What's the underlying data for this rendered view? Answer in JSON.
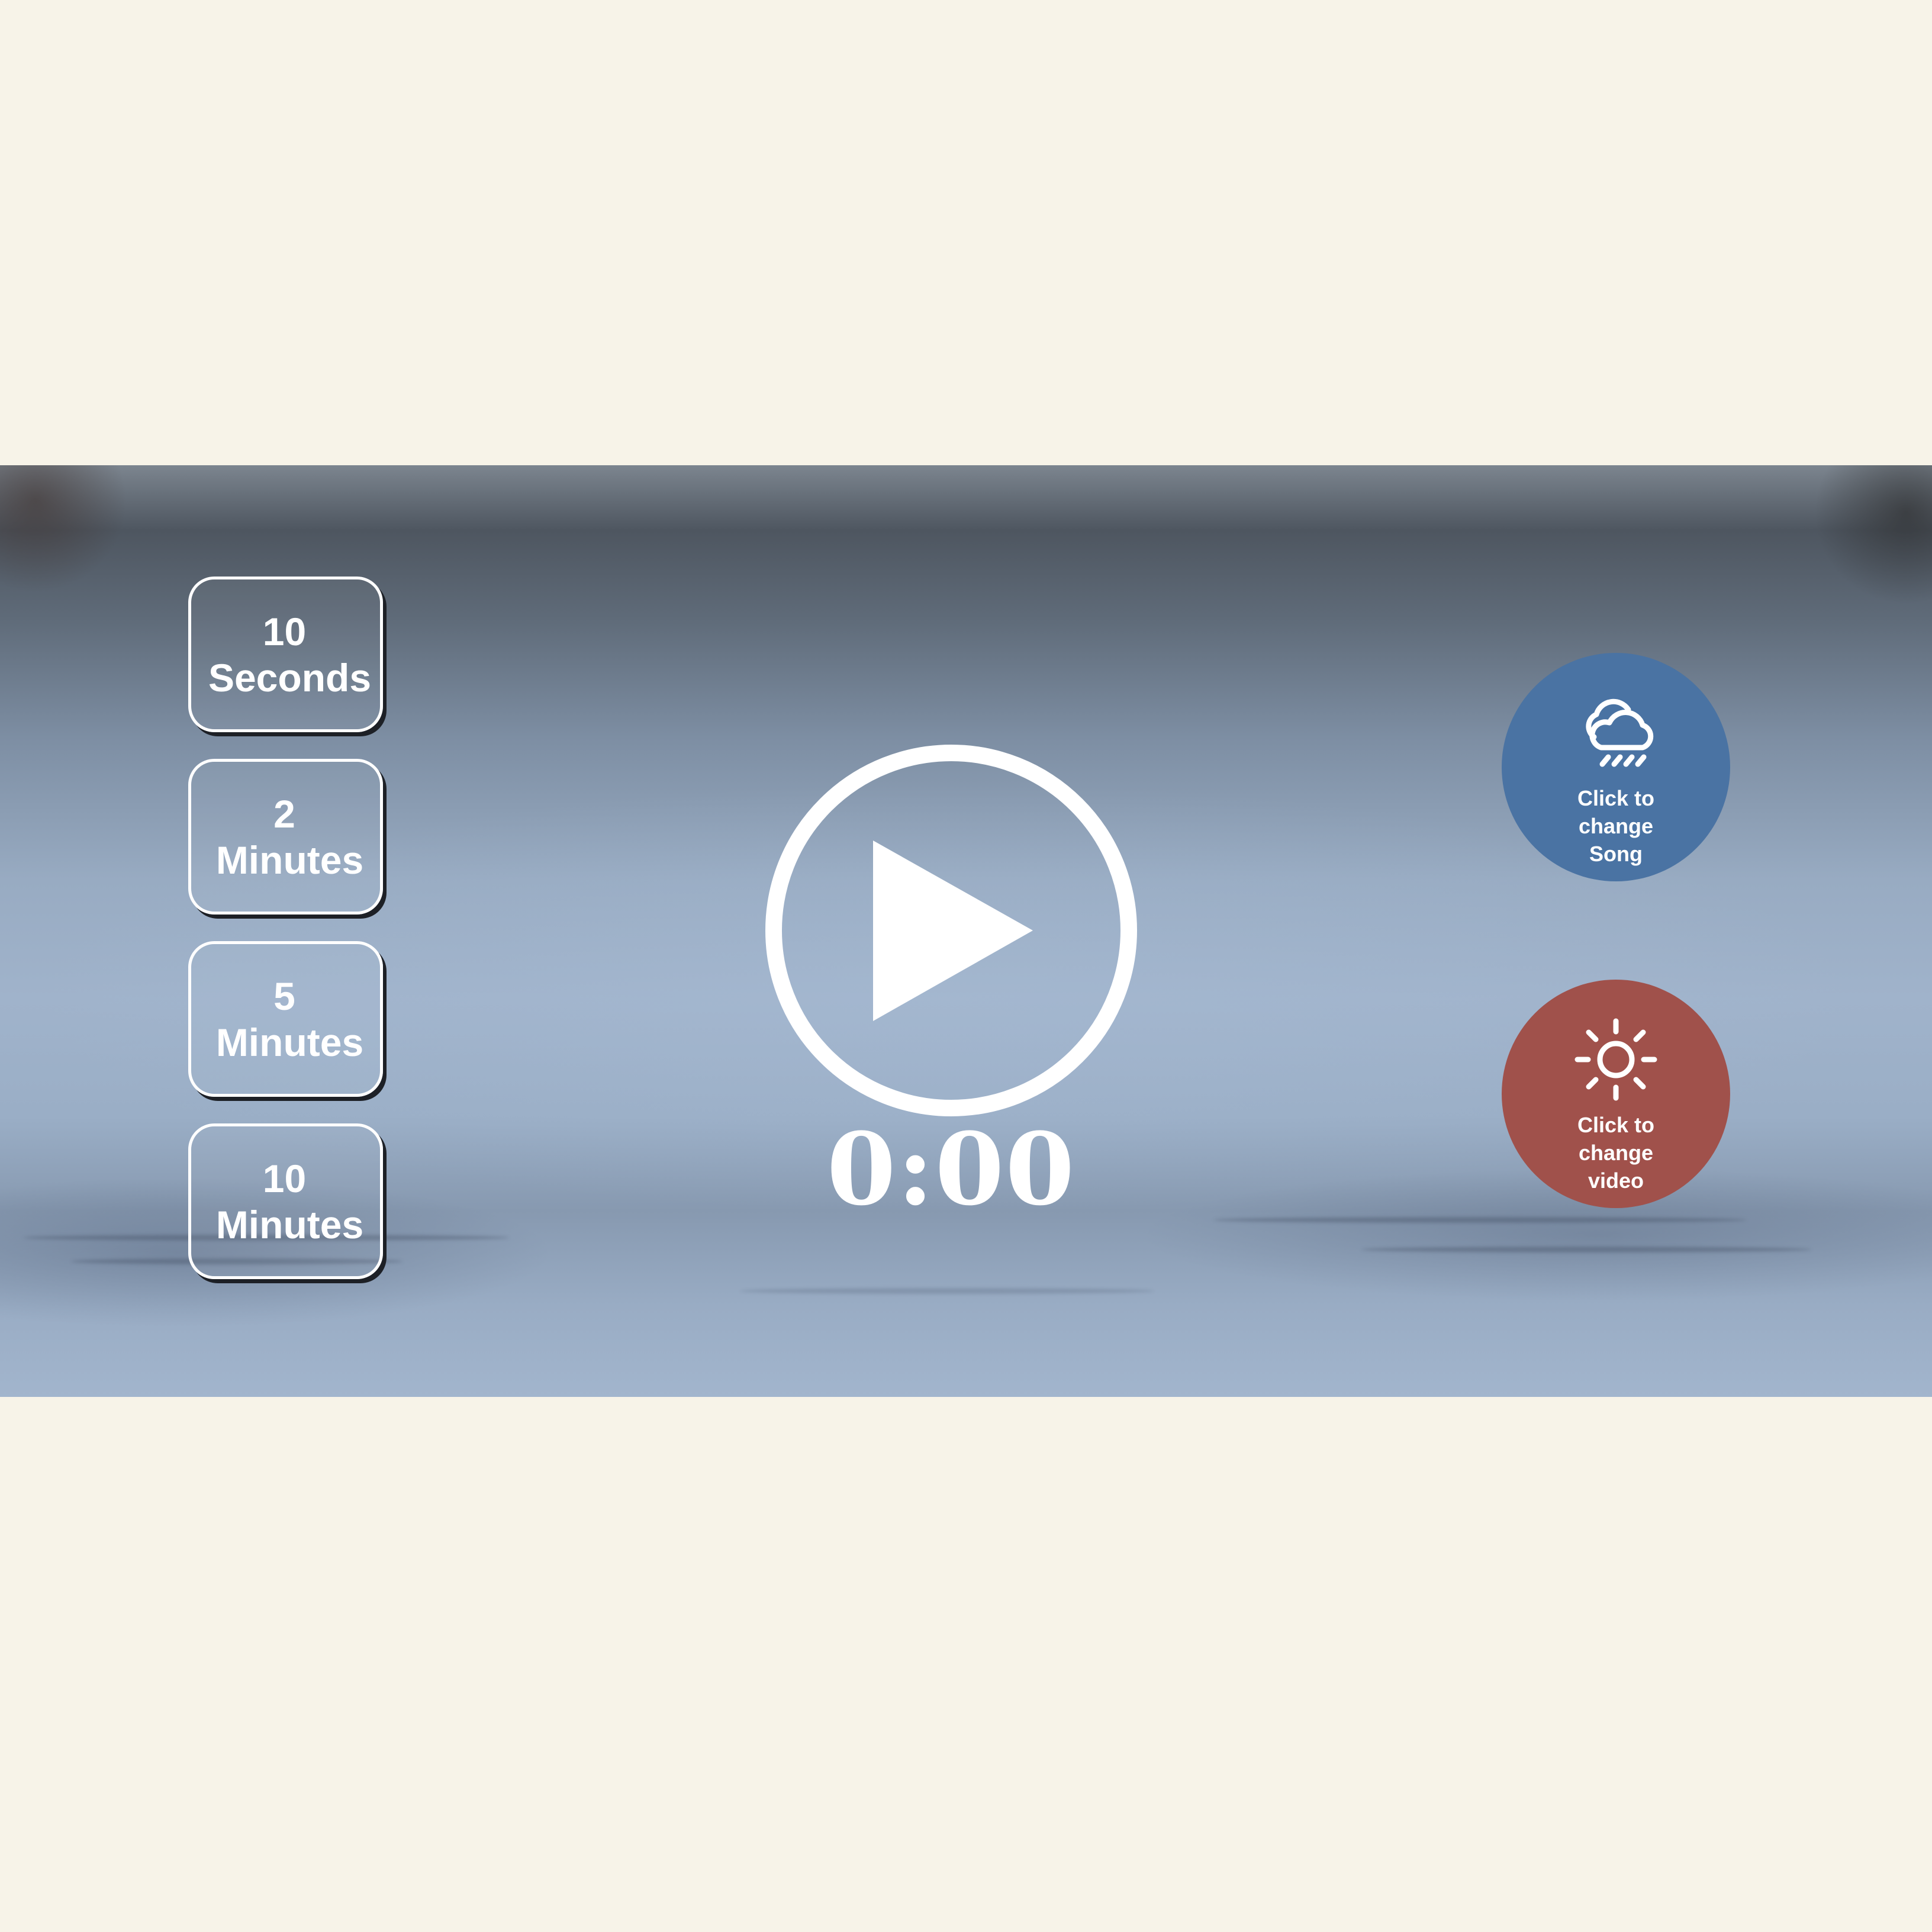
{
  "durations": [
    {
      "line1": "10",
      "line2": "Seconds"
    },
    {
      "line1": "2",
      "line2": "Minutes"
    },
    {
      "line1": "5",
      "line2": "Minutes"
    },
    {
      "line1": "10",
      "line2": "Minutes"
    }
  ],
  "timer": {
    "display": "0:00"
  },
  "song_button": {
    "icon": "cloud-rain-icon",
    "line1": "Click to",
    "line2": "change",
    "line3": "Song",
    "color": "#4a73a3"
  },
  "video_button": {
    "icon": "sun-icon",
    "line1": "Click to",
    "line2": "change",
    "line3": "video",
    "color": "#a0514b"
  },
  "colors": {
    "page_background": "#f7f3e8",
    "accent": "#ffffff"
  }
}
